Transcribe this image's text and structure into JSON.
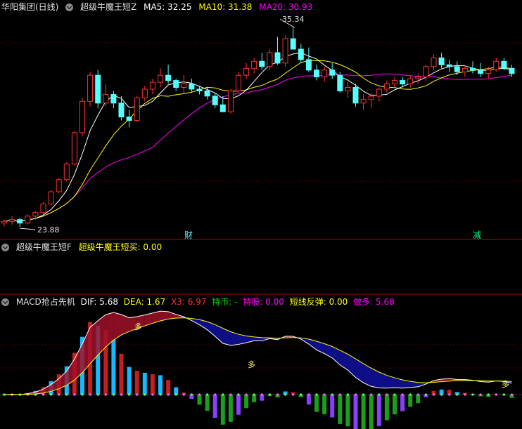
{
  "main_header": {
    "stock": "华阳集团(日线)",
    "indicator": "超级牛魔王短Z",
    "ma5": "MA5: 32.25",
    "ma10": "MA10: 31.38",
    "ma20": "MA20: 30.93"
  },
  "annotations": {
    "high": "35.34",
    "low": "23.88",
    "fin_marker": "财",
    "reduce_marker": "减"
  },
  "sub1_header": {
    "name": "超级牛魔王短F",
    "buy": "超级牛魔王短买: 0.00"
  },
  "sub2_header": {
    "name": "MACD抢占先机",
    "dif": "DIF: 5.68",
    "dea": "DEA: 1.67",
    "x3": "X3: 6.97",
    "hold_cash": "持币: -",
    "hold_stock": "持股: 0.00",
    "rebound": "短线反弹: 0.00",
    "long": "做多: 5.68"
  },
  "macd_labels": [
    "多",
    "多",
    "多"
  ],
  "colors": {
    "up": "#ff3232",
    "down": "#54ffff",
    "ma5": "#ffffff",
    "ma10": "#ffff00",
    "ma20": "#ff00ff",
    "grid": "#8b0000",
    "divider": "#b40000"
  },
  "chart_data": [
    {
      "type": "candlestick",
      "title": "华阳集团(日线)",
      "series": [
        {
          "name": "MA5",
          "color": "#ffffff"
        },
        {
          "name": "MA10",
          "color": "#ffff00"
        },
        {
          "name": "MA20",
          "color": "#ff00ff"
        }
      ],
      "ylim": [
        23.4,
        36.2
      ],
      "ohlc": [
        [
          24.1,
          24.3,
          23.9,
          24.2
        ],
        [
          24.2,
          24.5,
          24.0,
          24.3
        ],
        [
          24.3,
          24.4,
          23.88,
          24.1
        ],
        [
          24.1,
          24.6,
          24.0,
          24.5
        ],
        [
          24.5,
          24.8,
          24.3,
          24.7
        ],
        [
          24.7,
          25.3,
          24.6,
          25.2
        ],
        [
          25.2,
          26.0,
          25.1,
          25.9
        ],
        [
          25.9,
          26.7,
          25.8,
          26.6
        ],
        [
          26.6,
          27.6,
          26.5,
          27.5
        ],
        [
          27.5,
          29.4,
          27.4,
          29.3
        ],
        [
          29.3,
          31.3,
          29.1,
          31.1
        ],
        [
          31.1,
          32.8,
          30.8,
          32.6
        ],
        [
          32.6,
          32.9,
          30.7,
          31.0
        ],
        [
          31.0,
          32.1,
          30.8,
          31.5
        ],
        [
          31.5,
          31.7,
          30.7,
          31.0
        ],
        [
          31.0,
          31.4,
          30.0,
          30.2
        ],
        [
          30.2,
          30.6,
          29.6,
          30.0
        ],
        [
          30.0,
          31.4,
          29.9,
          31.3
        ],
        [
          31.3,
          32.0,
          31.1,
          31.8
        ],
        [
          31.8,
          32.4,
          31.5,
          32.2
        ],
        [
          32.2,
          33.0,
          31.9,
          32.6
        ],
        [
          32.6,
          33.2,
          32.1,
          32.3
        ],
        [
          32.3,
          32.4,
          31.7,
          31.9
        ],
        [
          31.9,
          32.6,
          31.6,
          32.1
        ],
        [
          32.1,
          32.4,
          31.6,
          31.8
        ],
        [
          31.8,
          32.0,
          31.5,
          31.7
        ],
        [
          31.7,
          31.9,
          31.2,
          31.4
        ],
        [
          31.4,
          31.6,
          30.7,
          30.9
        ],
        [
          30.9,
          31.4,
          30.5,
          30.5
        ],
        [
          30.5,
          31.8,
          30.4,
          31.7
        ],
        [
          31.7,
          32.8,
          31.6,
          32.6
        ],
        [
          32.6,
          33.3,
          32.4,
          33.0
        ],
        [
          33.0,
          33.6,
          32.7,
          33.4
        ],
        [
          33.4,
          33.9,
          32.9,
          33.1
        ],
        [
          33.1,
          34.1,
          32.9,
          33.9
        ],
        [
          33.9,
          34.8,
          33.2,
          33.3
        ],
        [
          33.3,
          34.9,
          33.1,
          34.7
        ],
        [
          34.7,
          35.34,
          34.2,
          34.1
        ],
        [
          34.1,
          34.4,
          33.3,
          33.5
        ],
        [
          33.5,
          34.2,
          32.8,
          32.9
        ],
        [
          32.9,
          33.2,
          32.3,
          32.5
        ],
        [
          32.5,
          33.1,
          32.2,
          32.9
        ],
        [
          32.9,
          33.3,
          32.4,
          32.6
        ],
        [
          32.6,
          32.8,
          31.6,
          31.7
        ],
        [
          31.7,
          32.2,
          31.3,
          31.9
        ],
        [
          31.9,
          32.1,
          30.8,
          31.0
        ],
        [
          31.0,
          31.5,
          30.6,
          31.2
        ],
        [
          31.2,
          31.6,
          30.7,
          31.4
        ],
        [
          31.4,
          31.9,
          31.1,
          31.8
        ],
        [
          31.8,
          32.3,
          31.6,
          32.1
        ],
        [
          32.1,
          32.5,
          31.9,
          32.3
        ],
        [
          32.3,
          32.5,
          31.9,
          32.1
        ],
        [
          32.1,
          32.6,
          31.9,
          32.4
        ],
        [
          32.4,
          32.7,
          32.1,
          32.5
        ],
        [
          32.5,
          33.2,
          32.3,
          33.1
        ],
        [
          33.1,
          33.8,
          32.9,
          33.6
        ],
        [
          33.6,
          33.9,
          33.0,
          33.2
        ],
        [
          33.2,
          33.5,
          32.8,
          33.1
        ],
        [
          33.1,
          33.4,
          32.6,
          32.8
        ],
        [
          32.8,
          33.2,
          32.5,
          33.0
        ],
        [
          33.0,
          33.4,
          32.7,
          32.9
        ],
        [
          32.9,
          33.3,
          32.5,
          32.7
        ],
        [
          32.7,
          33.1,
          32.4,
          32.9
        ],
        [
          32.9,
          33.6,
          32.8,
          33.4
        ],
        [
          33.4,
          33.6,
          32.9,
          33.0
        ],
        [
          33.0,
          33.2,
          32.5,
          32.7
        ]
      ]
    },
    {
      "type": "line",
      "title": "超级牛魔王短F",
      "series": [
        {
          "name": "超级牛魔王短买",
          "values": [
            0.0
          ]
        }
      ]
    },
    {
      "type": "bar",
      "title": "MACD抢占先机",
      "series": [
        {
          "name": "DIF",
          "last": 5.68
        },
        {
          "name": "DEA",
          "last": 1.67
        },
        {
          "name": "X3",
          "last": 6.97
        },
        {
          "name": "持股",
          "last": 0.0
        },
        {
          "name": "短线反弹",
          "last": 0.0
        },
        {
          "name": "做多",
          "last": 5.68
        }
      ]
    }
  ]
}
